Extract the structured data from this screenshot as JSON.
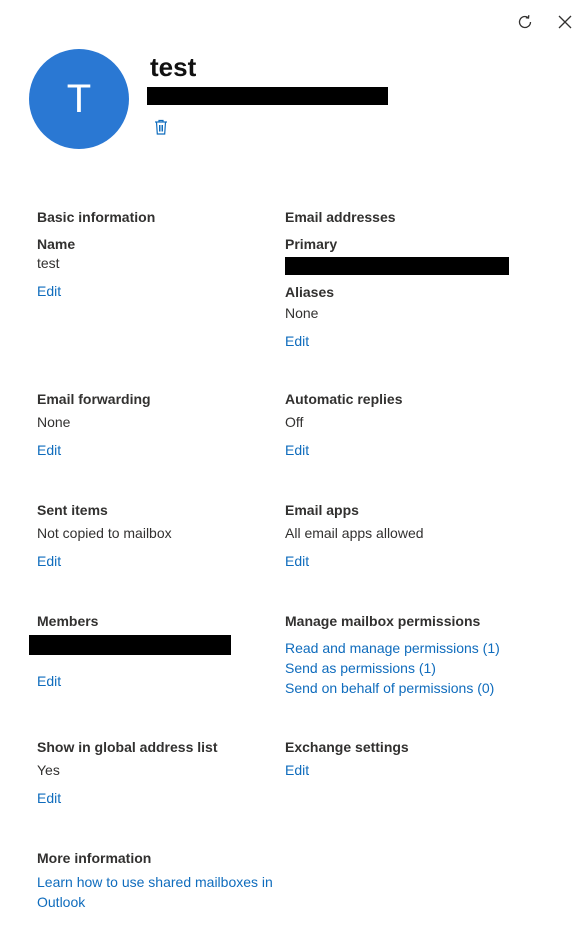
{
  "header": {
    "avatar_initial": "T",
    "title": "test"
  },
  "icons": {
    "refresh": "refresh-icon",
    "close": "close-icon",
    "delete": "trash-icon"
  },
  "colors": {
    "avatar_bg": "#2a78d3",
    "link": "#0f6cbd"
  },
  "basic_information": {
    "heading": "Basic information",
    "name_label": "Name",
    "name_value": "test",
    "edit": "Edit"
  },
  "email_addresses": {
    "heading": "Email addresses",
    "primary_label": "Primary",
    "aliases_label": "Aliases",
    "aliases_value": "None",
    "edit": "Edit"
  },
  "email_forwarding": {
    "heading": "Email forwarding",
    "value": "None",
    "edit": "Edit"
  },
  "automatic_replies": {
    "heading": "Automatic replies",
    "value": "Off",
    "edit": "Edit"
  },
  "sent_items": {
    "heading": "Sent items",
    "value": "Not copied to mailbox",
    "edit": "Edit"
  },
  "email_apps": {
    "heading": "Email apps",
    "value": "All email apps allowed",
    "edit": "Edit"
  },
  "members": {
    "heading": "Members",
    "edit": "Edit"
  },
  "mailbox_permissions": {
    "heading": "Manage mailbox permissions",
    "links": [
      "Read and manage permissions (1)",
      "Send as permissions (1)",
      "Send on behalf of permissions (0)"
    ]
  },
  "global_address_list": {
    "heading": "Show in global address list",
    "value": "Yes",
    "edit": "Edit"
  },
  "exchange_settings": {
    "heading": "Exchange settings",
    "edit": "Edit"
  },
  "more_information": {
    "heading": "More information",
    "link": "Learn how to use shared mailboxes in Outlook"
  }
}
